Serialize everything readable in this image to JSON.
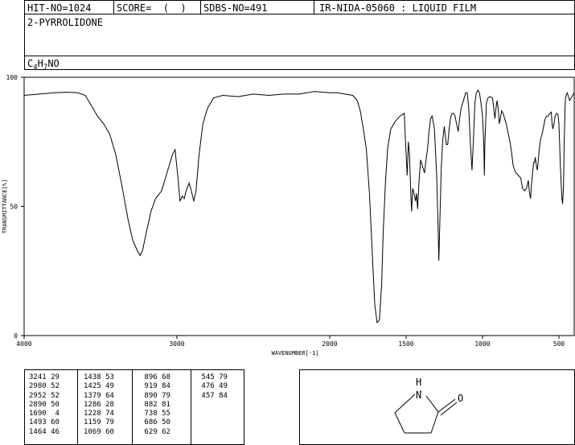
{
  "header": {
    "hit_no": "HIT-NO=1024",
    "score": "SCORE=  (  )",
    "sdbs_no": "SDBS-NO=491",
    "ir_id": "IR-NIDA-05060 : LIQUID FILM"
  },
  "compound": {
    "name": "2-PYRROLIDONE",
    "formula_parts": [
      {
        "text": "C",
        "sub": false
      },
      {
        "text": "4",
        "sub": true
      },
      {
        "text": "H",
        "sub": false
      },
      {
        "text": "7",
        "sub": true
      },
      {
        "text": "NO",
        "sub": false
      }
    ]
  },
  "chart_data": {
    "type": "line",
    "xlabel": "WAVENUMBER[-1]",
    "ylabel": "TRANSMITTANCE[%]",
    "xlim": [
      4000,
      400
    ],
    "ylim": [
      0,
      100
    ],
    "x_ticks": [
      4000,
      3000,
      2000,
      1500,
      1000,
      500
    ],
    "y_ticks": [
      0,
      50,
      100
    ],
    "series": [
      {
        "color": "#000000",
        "points": [
          [
            4000,
            93
          ],
          [
            3900,
            93.5
          ],
          [
            3800,
            94
          ],
          [
            3720,
            94.2
          ],
          [
            3650,
            94
          ],
          [
            3600,
            93
          ],
          [
            3560,
            89
          ],
          [
            3520,
            85
          ],
          [
            3480,
            82
          ],
          [
            3440,
            78
          ],
          [
            3400,
            70
          ],
          [
            3360,
            58
          ],
          [
            3320,
            45
          ],
          [
            3290,
            37
          ],
          [
            3260,
            33
          ],
          [
            3241,
            31
          ],
          [
            3225,
            33
          ],
          [
            3200,
            40
          ],
          [
            3170,
            48
          ],
          [
            3140,
            53
          ],
          [
            3100,
            56
          ],
          [
            3060,
            64
          ],
          [
            3030,
            70
          ],
          [
            3012,
            72
          ],
          [
            2995,
            62
          ],
          [
            2980,
            52
          ],
          [
            2965,
            54
          ],
          [
            2952,
            53
          ],
          [
            2940,
            56
          ],
          [
            2920,
            59
          ],
          [
            2905,
            56
          ],
          [
            2890,
            52
          ],
          [
            2875,
            56
          ],
          [
            2855,
            70
          ],
          [
            2830,
            82
          ],
          [
            2800,
            88
          ],
          [
            2760,
            92
          ],
          [
            2700,
            93
          ],
          [
            2600,
            92.5
          ],
          [
            2500,
            93.5
          ],
          [
            2400,
            93
          ],
          [
            2300,
            93.5
          ],
          [
            2200,
            93.5
          ],
          [
            2100,
            94.5
          ],
          [
            2000,
            94
          ],
          [
            1950,
            94
          ],
          [
            1900,
            93.5
          ],
          [
            1850,
            93
          ],
          [
            1820,
            91
          ],
          [
            1800,
            87
          ],
          [
            1780,
            80
          ],
          [
            1760,
            72
          ],
          [
            1740,
            55
          ],
          [
            1720,
            30
          ],
          [
            1705,
            12
          ],
          [
            1690,
            5
          ],
          [
            1675,
            6
          ],
          [
            1660,
            20
          ],
          [
            1650,
            40
          ],
          [
            1635,
            60
          ],
          [
            1620,
            73
          ],
          [
            1600,
            80
          ],
          [
            1570,
            83
          ],
          [
            1540,
            85
          ],
          [
            1512,
            86
          ],
          [
            1505,
            76
          ],
          [
            1493,
            62
          ],
          [
            1485,
            75
          ],
          [
            1478,
            70
          ],
          [
            1470,
            56
          ],
          [
            1464,
            48
          ],
          [
            1457,
            57
          ],
          [
            1448,
            55
          ],
          [
            1438,
            52
          ],
          [
            1432,
            55
          ],
          [
            1425,
            49
          ],
          [
            1415,
            60
          ],
          [
            1405,
            68
          ],
          [
            1395,
            66
          ],
          [
            1385,
            64
          ],
          [
            1379,
            63
          ],
          [
            1370,
            68
          ],
          [
            1360,
            72
          ],
          [
            1350,
            79
          ],
          [
            1340,
            84
          ],
          [
            1330,
            85
          ],
          [
            1315,
            80
          ],
          [
            1300,
            62
          ],
          [
            1290,
            40
          ],
          [
            1286,
            29
          ],
          [
            1281,
            40
          ],
          [
            1270,
            65
          ],
          [
            1260,
            76
          ],
          [
            1250,
            81
          ],
          [
            1245,
            78
          ],
          [
            1237,
            74
          ],
          [
            1228,
            74
          ],
          [
            1220,
            79
          ],
          [
            1210,
            84
          ],
          [
            1200,
            86
          ],
          [
            1190,
            86
          ],
          [
            1180,
            85
          ],
          [
            1170,
            82
          ],
          [
            1159,
            79
          ],
          [
            1150,
            84
          ],
          [
            1140,
            88
          ],
          [
            1120,
            92
          ],
          [
            1110,
            94
          ],
          [
            1100,
            94
          ],
          [
            1090,
            88
          ],
          [
            1080,
            75
          ],
          [
            1069,
            64
          ],
          [
            1060,
            75
          ],
          [
            1050,
            90
          ],
          [
            1040,
            94
          ],
          [
            1030,
            95
          ],
          [
            1020,
            94
          ],
          [
            1010,
            90
          ],
          [
            1000,
            85
          ],
          [
            992,
            75
          ],
          [
            988,
            62
          ],
          [
            984,
            75
          ],
          [
            975,
            90
          ],
          [
            965,
            92
          ],
          [
            950,
            92.5
          ],
          [
            935,
            92
          ],
          [
            925,
            87
          ],
          [
            919,
            84
          ],
          [
            912,
            88
          ],
          [
            905,
            91
          ],
          [
            896,
            87
          ],
          [
            890,
            82
          ],
          [
            883,
            84
          ],
          [
            875,
            87
          ],
          [
            865,
            86
          ],
          [
            855,
            84
          ],
          [
            845,
            82
          ],
          [
            835,
            79
          ],
          [
            820,
            75
          ],
          [
            810,
            71
          ],
          [
            800,
            66
          ],
          [
            790,
            64
          ],
          [
            780,
            63
          ],
          [
            765,
            62
          ],
          [
            750,
            61
          ],
          [
            738,
            57
          ],
          [
            725,
            56
          ],
          [
            712,
            57
          ],
          [
            700,
            60
          ],
          [
            694,
            56
          ],
          [
            686,
            53
          ],
          [
            680,
            58
          ],
          [
            672,
            63
          ],
          [
            665,
            67
          ],
          [
            660,
            67
          ],
          [
            655,
            69
          ],
          [
            648,
            66
          ],
          [
            641,
            64
          ],
          [
            635,
            68
          ],
          [
            629,
            72
          ],
          [
            620,
            76
          ],
          [
            610,
            78
          ],
          [
            600,
            81
          ],
          [
            590,
            84
          ],
          [
            580,
            85
          ],
          [
            570,
            85
          ],
          [
            560,
            86
          ],
          [
            550,
            86.5
          ],
          [
            545,
            82
          ],
          [
            540,
            80
          ],
          [
            532,
            82
          ],
          [
            525,
            85
          ],
          [
            515,
            86
          ],
          [
            506,
            85.5
          ],
          [
            500,
            82
          ],
          [
            495,
            74
          ],
          [
            490,
            65
          ],
          [
            485,
            58
          ],
          [
            480,
            53
          ],
          [
            476,
            51
          ],
          [
            470,
            58
          ],
          [
            465,
            75
          ],
          [
            460,
            88
          ],
          [
            457,
            92
          ],
          [
            452,
            93
          ],
          [
            446,
            94
          ],
          [
            440,
            93
          ],
          [
            430,
            91
          ],
          [
            420,
            92
          ],
          [
            410,
            93
          ],
          [
            400,
            94
          ]
        ]
      }
    ]
  },
  "peak_table": [
    [
      "3241 29",
      "2980 52",
      "2952 52",
      "2890 50",
      "1690  4",
      "1493 60",
      "1464 46"
    ],
    [
      "1438 53",
      "1425 49",
      "1379 64",
      "1286 28",
      "1228 74",
      "1159 79",
      "1069 60"
    ],
    [
      " 896 68",
      " 919 84",
      " 890 79",
      " 882 81",
      " 738 55",
      " 686 50",
      " 629 62"
    ],
    [
      " 545 79",
      " 476 49",
      " 457 84"
    ]
  ],
  "structure": {
    "atom_n": "N",
    "atom_h": "H",
    "atom_o": "O"
  }
}
